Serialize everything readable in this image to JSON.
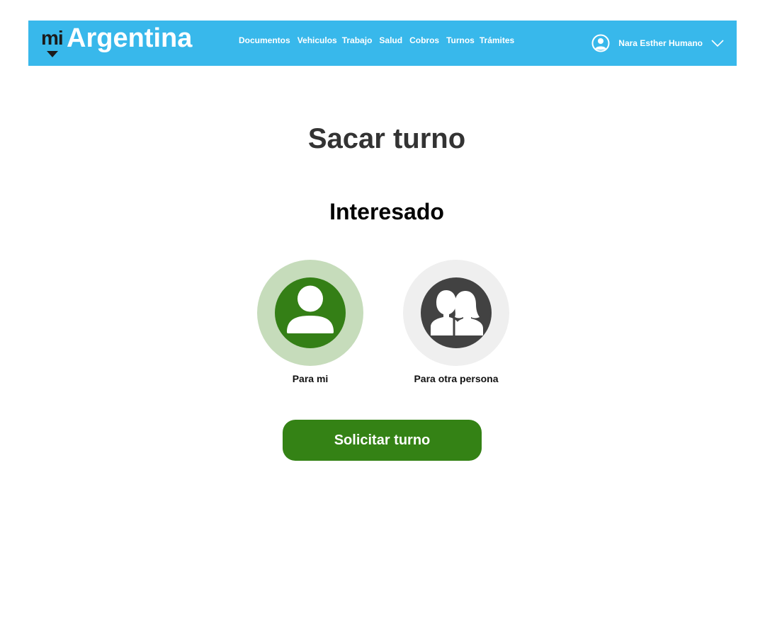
{
  "header": {
    "logo_prefix": "mi",
    "logo_brand": "Argentina",
    "nav": [
      {
        "label": "Documentos"
      },
      {
        "label": "Vehiculos"
      },
      {
        "label": "Trabajo"
      },
      {
        "label": "Salud"
      },
      {
        "label": "Cobros"
      },
      {
        "label": "Turnos"
      },
      {
        "label": "Trámites"
      }
    ],
    "user_name": "Nara Esther Humano",
    "user_icon": "user-circle-icon",
    "menu_icon": "chevron-down-icon"
  },
  "main": {
    "title": "Sacar turno",
    "section_title": "Interesado",
    "options": [
      {
        "label": "Para mi",
        "icon": "single-person-icon",
        "selected": true
      },
      {
        "label": "Para otra persona",
        "icon": "two-people-icon",
        "selected": false
      }
    ],
    "submit_label": "Solicitar turno"
  },
  "colors": {
    "header_bg": "#38b8eb",
    "accent_green": "#348215",
    "selected_ring": "#c6dcbb",
    "unselected_ring": "#efefef",
    "unselected_disc": "#424242"
  }
}
